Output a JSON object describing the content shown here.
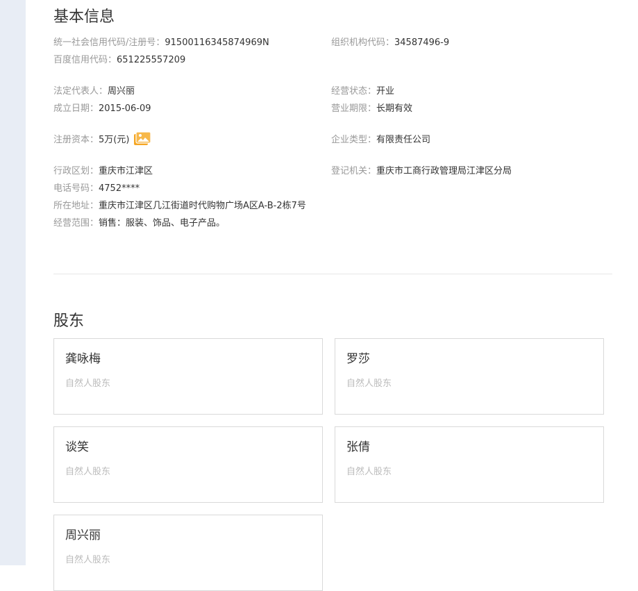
{
  "basic_info": {
    "title": "基本信息",
    "credit_code_label": "统一社会信用代码/注册号：",
    "credit_code_value": "91500116345874969N",
    "org_code_label": "组织机构代码：",
    "org_code_value": "34587496-9",
    "baidu_code_label": "百度信用代码：",
    "baidu_code_value": "651225557209",
    "legal_rep_label": "法定代表人：",
    "legal_rep_value": "周兴丽",
    "status_label": "经营状态：",
    "status_value": "开业",
    "founded_label": "成立日期：",
    "founded_value": "2015-06-09",
    "term_label": "营业期限：",
    "term_value": "长期有效",
    "capital_label": "注册资本：",
    "capital_value": "5万(元)",
    "capital_icon": "image-icon",
    "company_type_label": "企业类型：",
    "company_type_value": "有限责任公司",
    "district_label": "行政区划：",
    "district_value": "重庆市江津区",
    "registry_label": "登记机关：",
    "registry_value": "重庆市工商行政管理局江津区分局",
    "phone_label": "电话号码：",
    "phone_value": "4752****",
    "address_label": "所在地址：",
    "address_value": "重庆市江津区几江街道时代购物广场A区A-B-2栋7号",
    "scope_label": "经营范围：",
    "scope_value": "销售：服装、饰品、电子产品。"
  },
  "shareholders": {
    "title": "股东",
    "items": [
      {
        "name": "龚咏梅",
        "type": "自然人股东"
      },
      {
        "name": "罗莎",
        "type": "自然人股东"
      },
      {
        "name": "谈笑",
        "type": "自然人股东"
      },
      {
        "name": "张倩",
        "type": "自然人股东"
      },
      {
        "name": "周兴丽",
        "type": "自然人股东"
      }
    ]
  },
  "colors": {
    "label": "#999999",
    "value": "#333333",
    "rail": "#e8edf5",
    "icon_accent": "#f5a623"
  }
}
